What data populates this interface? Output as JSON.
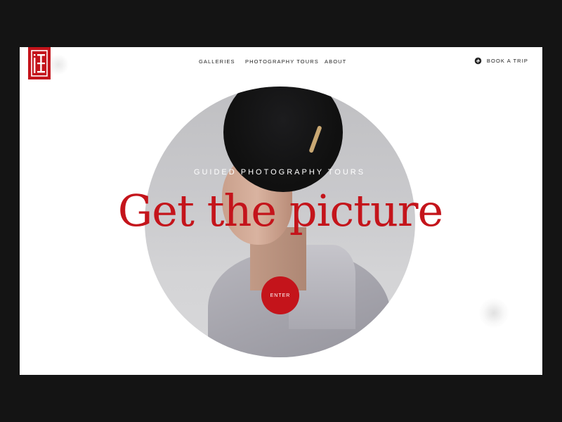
{
  "brand": {
    "logo_name": "ja-monogram-logo",
    "accent_color": "#c4141b"
  },
  "nav": {
    "items": [
      {
        "label": "GALLERIES"
      },
      {
        "label": "PHOTOGRAPHY TOURS"
      },
      {
        "label": "ABOUT"
      }
    ],
    "book_label": "BOOK A TRIP",
    "book_icon": "camera-aperture-icon"
  },
  "hero": {
    "subtitle": "GUIDED PHOTOGRAPHY TOURS",
    "headline": "Get the picture",
    "cta_label": "ENTER"
  }
}
